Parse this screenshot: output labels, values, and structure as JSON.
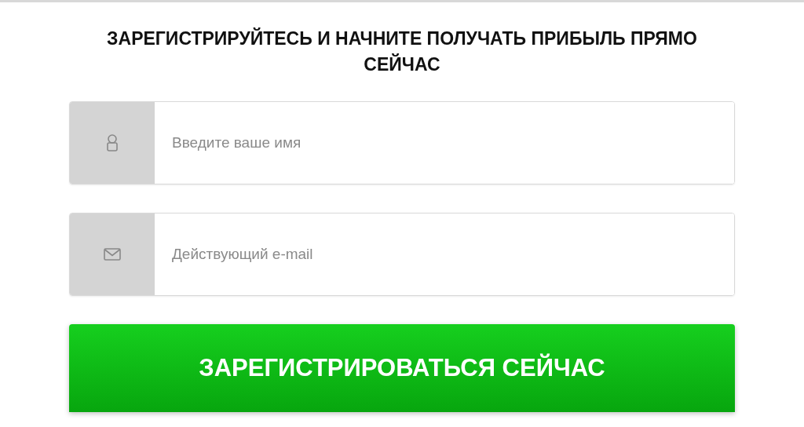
{
  "heading": "ЗАРЕГИСТРИРУЙТЕСЬ И НАЧНИТЕ ПОЛУЧАТЬ ПРИБЫЛЬ ПРЯМО СЕЙЧАС",
  "fields": [
    {
      "kind": "name",
      "placeholder": "Введите ваше имя"
    },
    {
      "kind": "email",
      "placeholder": "Действующий e-mail"
    }
  ],
  "submit_button": "ЗАРЕГИСТРИРОВАТЬСЯ СЕЙЧАС"
}
